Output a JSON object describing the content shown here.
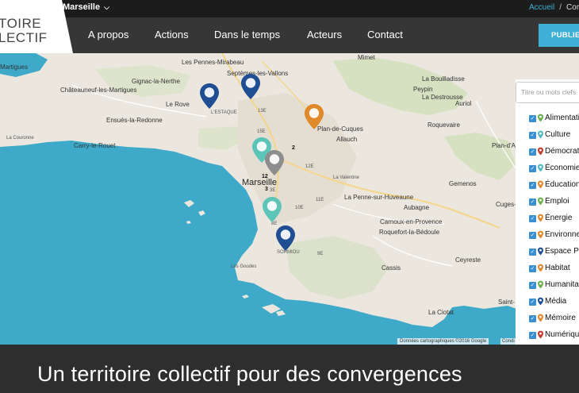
{
  "topbar": {
    "city": "Marseille",
    "breadcrumb_home": "Accueil",
    "breadcrumb_sep": "/",
    "breadcrumb_next": "Con"
  },
  "logo": {
    "line1": "TOIRE",
    "line2": "LECTIF"
  },
  "nav": {
    "items": [
      "A propos",
      "Actions",
      "Dans le temps",
      "Acteurs",
      "Contact"
    ],
    "publish": "PUBLIER"
  },
  "map": {
    "labels": [
      "Les Pennes-Mirabeau",
      "Mimet",
      "Martigues",
      "Gignac-la-Nerthe",
      "Septèmes-les-Vallons",
      "La Bouilladisse",
      "Châteauneuf-les-Martigues",
      "Peypin",
      "La Destrousse",
      "Le Rove",
      "Auriol",
      "Ensuès-la-Redonne",
      "Plan-de-Cuques",
      "Roquevaire",
      "La Couronne",
      "Carry-le-Rouet",
      "Allauch",
      "Plan-d'Ao",
      "La Valentine",
      "Marseille",
      "Gemenos",
      "Aubagne",
      "La Penne-sur-Huveaune",
      "Cuges-le",
      "Carnoux-en-Provence",
      "Roquefort-la-Bédoule",
      "Ceyreste",
      "Cassis",
      "Les Goudes",
      "La Ciotat",
      "Saint-"
    ],
    "small_labels": [
      "L'ESTAQUE",
      "13E",
      "15E",
      "3E",
      "12E",
      "8E",
      "9E",
      "SORMIOU",
      "11E",
      "10E"
    ],
    "clusters": [
      "2",
      "4",
      "5",
      "12",
      "3"
    ],
    "attribution": "Données cartographiques ©2016 Google",
    "attribution2": "Condi"
  },
  "pins": [
    {
      "color": "#1f4e93"
    },
    {
      "color": "#1f4e93"
    },
    {
      "color": "#e0892b"
    },
    {
      "color": "#5cc5b8"
    },
    {
      "color": "#8d8d8d"
    },
    {
      "color": "#5cc5b8"
    },
    {
      "color": "#1f4e93"
    }
  ],
  "filter": {
    "search_placeholder": "Titre ou mots clefs",
    "categories": [
      {
        "label": "Alimentation",
        "color": "#6ab04c"
      },
      {
        "label": "Culture",
        "color": "#53b9c7"
      },
      {
        "label": "Démocratie",
        "color": "#c0392b"
      },
      {
        "label": "Économie",
        "color": "#53b9c7"
      },
      {
        "label": "Éducation",
        "color": "#e0892b"
      },
      {
        "label": "Emploi",
        "color": "#6ab04c"
      },
      {
        "label": "Énergie",
        "color": "#e0892b"
      },
      {
        "label": "Environnement",
        "color": "#e0892b"
      },
      {
        "label": "Espace Public",
        "color": "#1f4e93"
      },
      {
        "label": "Habitat",
        "color": "#e0892b"
      },
      {
        "label": "Humanitaire",
        "color": "#6ab04c"
      },
      {
        "label": "Média",
        "color": "#1f4e93"
      },
      {
        "label": "Mémoire",
        "color": "#e0892b"
      },
      {
        "label": "Numérique",
        "color": "#c0392b"
      }
    ]
  },
  "footer": {
    "tagline": "Un territoire collectif pour des convergences"
  },
  "colors": {
    "accent": "#3fb0d5",
    "nav_bg": "#363636",
    "topbar_bg": "#1c1c1c",
    "sea": "#3fa9c9",
    "land": "#ebe7de"
  }
}
